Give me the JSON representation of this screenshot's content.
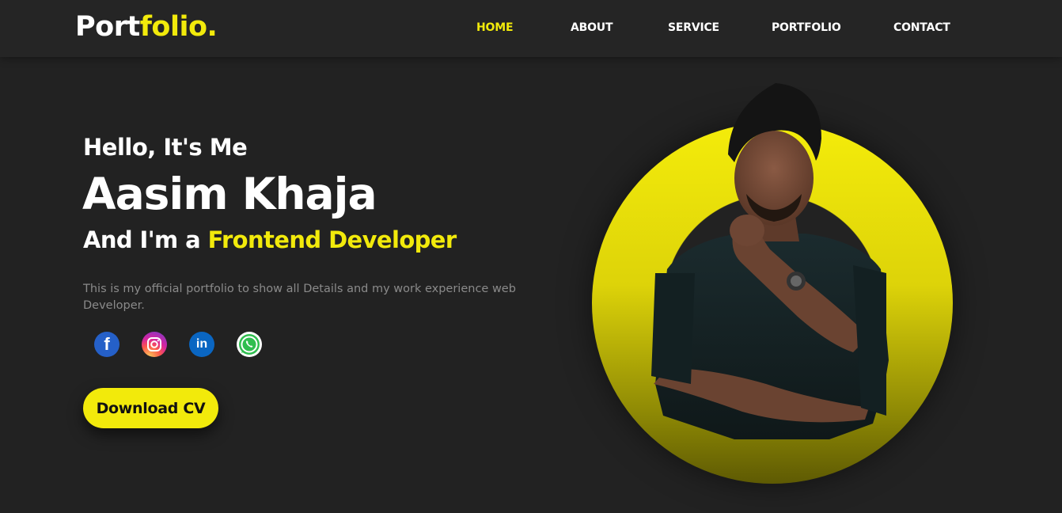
{
  "header": {
    "logo_main": "Port",
    "logo_highlight": "folio.",
    "nav": [
      {
        "label": "HOME",
        "active": true
      },
      {
        "label": "ABOUT"
      },
      {
        "label": "SERVICE"
      },
      {
        "label": "PORTFOLIO"
      },
      {
        "label": "CONTACT"
      }
    ]
  },
  "hero": {
    "greeting": "Hello, It's Me",
    "name": "Aasim Khaja",
    "role_prefix": "And I'm a",
    "role_highlight": "Frontend Developer",
    "description": "This is my official portfolio to show all Details and my work experience web Developer.",
    "socials": [
      {
        "icon": "facebook-icon"
      },
      {
        "icon": "instagram-icon"
      },
      {
        "icon": "linkedin-icon"
      },
      {
        "icon": "whatsapp-icon"
      }
    ],
    "cv_button": "Download CV"
  },
  "colors": {
    "accent": "#f2ea0b",
    "background": "#222222",
    "header_background": "#252525"
  }
}
